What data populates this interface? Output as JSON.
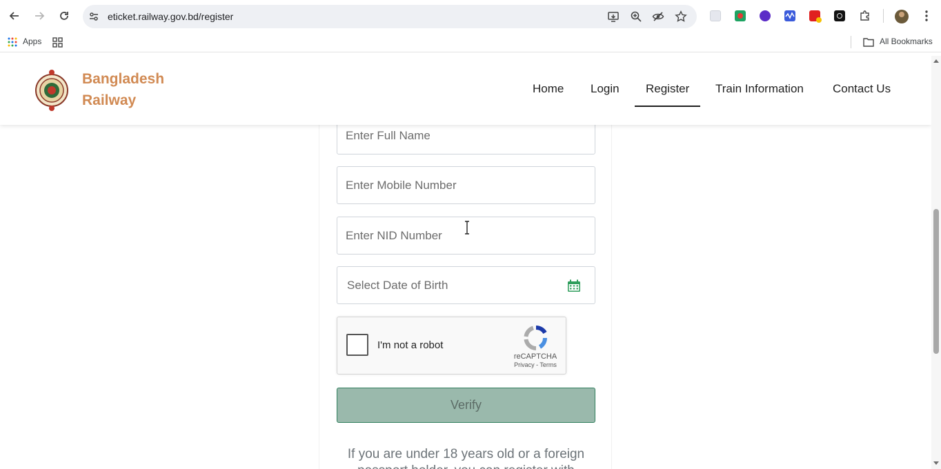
{
  "browser": {
    "url": "eticket.railway.gov.bd/register",
    "bookmarks": {
      "apps_label": "Apps",
      "all_bookmarks_label": "All Bookmarks"
    }
  },
  "header": {
    "brand_line1": "Bangladesh",
    "brand_line2": "Railway",
    "brand_color": "#d18a53",
    "nav": [
      {
        "label": "Home"
      },
      {
        "label": "Login"
      },
      {
        "label": "Register",
        "active": true
      },
      {
        "label": "Train Information"
      },
      {
        "label": "Contact Us"
      }
    ]
  },
  "form": {
    "full_name_placeholder": "Enter Full Name",
    "mobile_placeholder": "Enter Mobile Number",
    "nid_placeholder": "Enter NID Number",
    "dob_placeholder": "Select Date of Birth",
    "calendar_icon": "calendar-icon",
    "recaptcha": {
      "label": "I'm not a robot",
      "brand": "reCAPTCHA",
      "links": "Privacy - Terms"
    },
    "verify_label": "Verify",
    "verify_color": "#9ab9ac",
    "note_line1": "If you are under 18 years old or a foreign",
    "note_line2": "passport holder, you can register with"
  }
}
